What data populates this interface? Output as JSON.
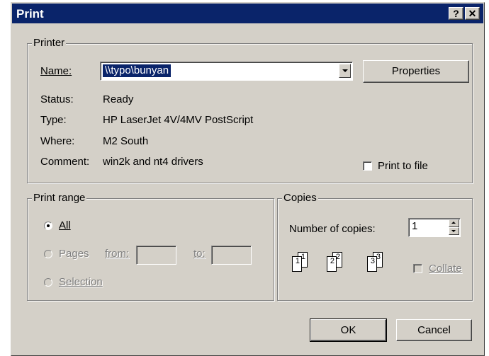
{
  "window": {
    "title": "Print",
    "help_btn": "?",
    "close_btn": "✕"
  },
  "printer": {
    "group_label": "Printer",
    "name_label": "Name:",
    "name_value": "\\\\typo\\bunyan",
    "properties_btn": "Properties",
    "status_label": "Status:",
    "status_value": "Ready",
    "type_label": "Type:",
    "type_value": "HP LaserJet 4V/4MV PostScript",
    "where_label": "Where:",
    "where_value": "M2 South",
    "comment_label": "Comment:",
    "comment_value": "win2k and nt4 drivers",
    "print_to_file_label": "Print to file",
    "print_to_file_checked": false
  },
  "print_range": {
    "group_label": "Print range",
    "all_label": "All",
    "all_selected": true,
    "pages_label": "Pages",
    "from_label": "from:",
    "to_label": "to:",
    "from_value": "",
    "to_value": "",
    "selection_label": "Selection"
  },
  "copies": {
    "group_label": "Copies",
    "number_label": "Number of copies:",
    "number_value": "1",
    "collate_label": "Collate",
    "collate_checked": false,
    "collate_icons": [
      "1",
      "1",
      "2",
      "2",
      "3",
      "3"
    ]
  },
  "buttons": {
    "ok": "OK",
    "cancel": "Cancel"
  },
  "colors": {
    "titlebar": "#0a246a",
    "face": "#d4d0c8"
  }
}
